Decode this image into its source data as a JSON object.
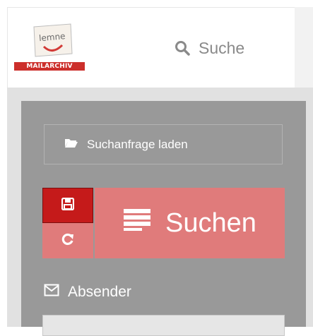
{
  "app": {
    "logo_text": "MAILARCHIV",
    "logo_wordmark": "lemne"
  },
  "header": {
    "search_label": "Suche"
  },
  "sidebar": {
    "load_query_label": "Suchanfrage laden",
    "search_button_label": "Suchen",
    "sender_label": "Absender",
    "sender_input_placeholder": ""
  },
  "icons": {
    "search": "search-icon",
    "folder": "folder-open-icon",
    "save": "floppy-disk-icon",
    "reset": "refresh-icon",
    "list": "list-icon",
    "envelope": "envelope-icon"
  },
  "colors": {
    "brand_red": "#cc2f2b",
    "save_red": "#c51a1a",
    "button_pink": "#e07b7b",
    "panel_gray": "#999999"
  }
}
